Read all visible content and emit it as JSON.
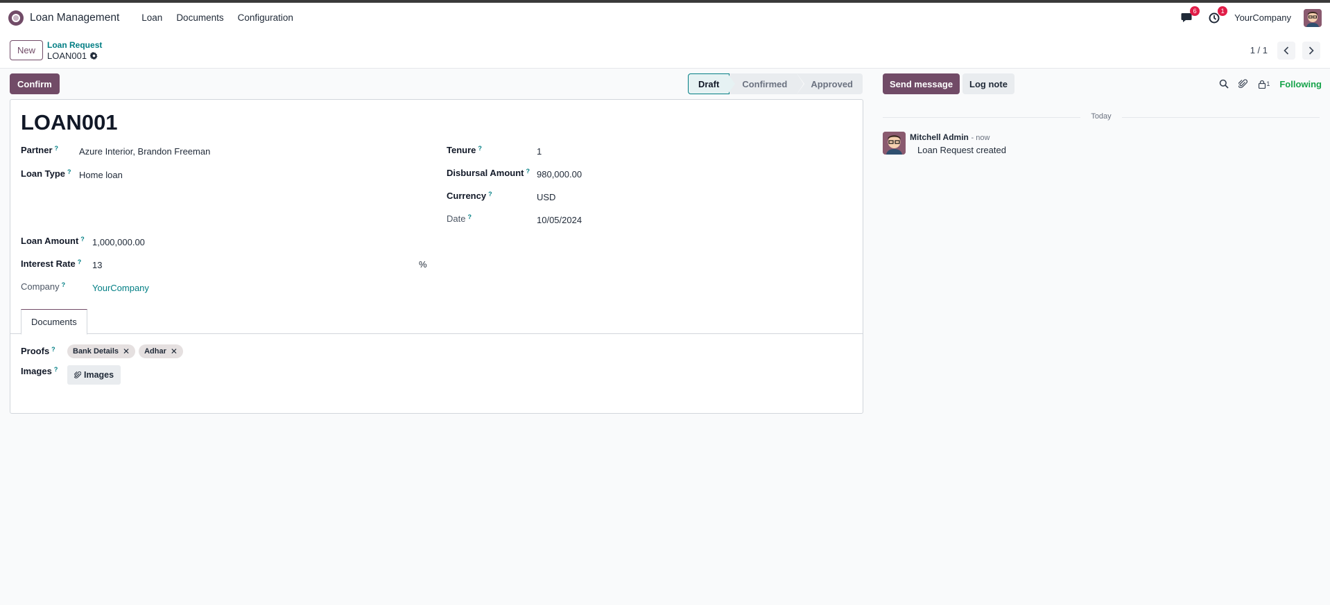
{
  "navbar": {
    "app_name": "Loan Management",
    "menu": [
      "Loan",
      "Documents",
      "Configuration"
    ],
    "messages_count": "6",
    "activities_count": "1",
    "company": "YourCompany"
  },
  "control": {
    "new_label": "New",
    "breadcrumb_parent": "Loan Request",
    "breadcrumb_current": "LOAN001",
    "pager": "1 / 1"
  },
  "actions": {
    "confirm_label": "Confirm",
    "states": [
      "Draft",
      "Confirmed",
      "Approved"
    ],
    "active_state": "Draft"
  },
  "form": {
    "title": "LOAN001",
    "partner_label": "Partner",
    "partner_value": "Azure Interior, Brandon Freeman",
    "loan_type_label": "Loan Type",
    "loan_type_value": "Home loan",
    "loan_amount_label": "Loan Amount",
    "loan_amount_value": "1,000,000.00",
    "interest_rate_label": "Interest Rate",
    "interest_rate_value": "13",
    "interest_rate_unit": "%",
    "company_label": "Company",
    "company_value": "YourCompany",
    "tenure_label": "Tenure",
    "tenure_value": "1",
    "disbursal_label": "Disbursal Amount",
    "disbursal_value": "980,000.00",
    "currency_label": "Currency",
    "currency_value": "USD",
    "date_label": "Date",
    "date_value": "10/05/2024",
    "help_mark": "?"
  },
  "tabs": {
    "documents_label": "Documents"
  },
  "documents": {
    "proofs_label": "Proofs",
    "proofs": [
      "Bank Details",
      "Adhar"
    ],
    "images_label": "Images",
    "images_button": "Images"
  },
  "chatter": {
    "send_message": "Send message",
    "log_note": "Log note",
    "follower_count": "1",
    "following": "Following",
    "date_separator": "Today",
    "message_author": "Mitchell Admin",
    "message_time": "- now",
    "message_body": "Loan Request created"
  },
  "colors": {
    "brand": "#714b67",
    "link": "#017e84",
    "following": "#16a34a",
    "badge": "#e11d48"
  }
}
